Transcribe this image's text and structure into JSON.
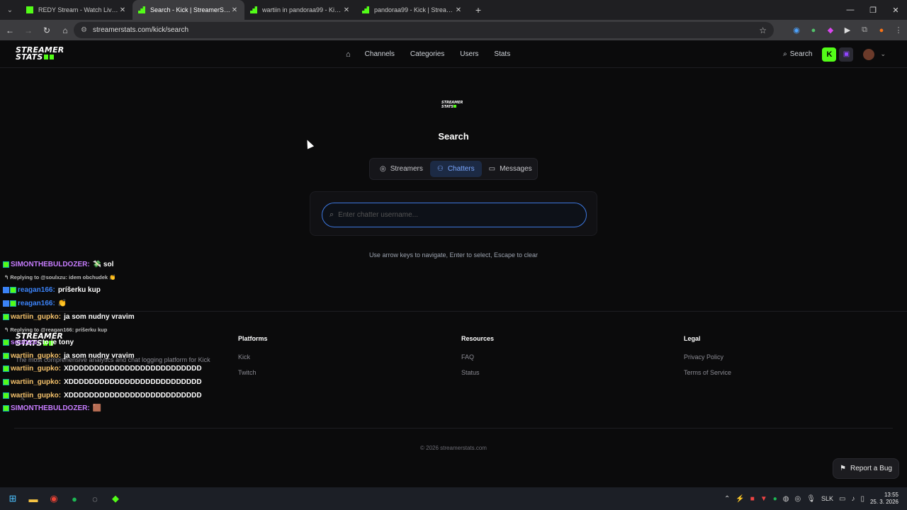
{
  "browser": {
    "tabs": [
      {
        "title": "REDY Stream - Watch Live on Kick",
        "favicon": "kick-icon",
        "color": "#53fc18",
        "active": false
      },
      {
        "title": "Search - Kick | StreamerStats",
        "favicon": "streamerstats-icon",
        "color": "#53fc18",
        "active": true
      },
      {
        "title": "wartiin in pandoraa99 - Kick | StreamerStats",
        "favicon": "streamerstats-icon",
        "color": "#53fc18",
        "active": false
      },
      {
        "title": "pandoraa99 - Kick | StreamerStats",
        "favicon": "streamerstats-icon",
        "color": "#53fc18",
        "active": false
      }
    ],
    "url": "streamerstats.com/kick/search"
  },
  "header": {
    "logo_line1": "STREAMER",
    "logo_line2": "STATS",
    "nav": [
      "Channels",
      "Categories",
      "Users",
      "Stats"
    ],
    "search_label": "Search"
  },
  "main": {
    "mini_logo_line1": "STREAMER",
    "mini_logo_line2": "STATS",
    "title": "Search",
    "segments": [
      {
        "label": "Streamers",
        "icon": "broadcast-icon",
        "active": false
      },
      {
        "label": "Chatters",
        "icon": "users-icon",
        "active": true
      },
      {
        "label": "Messages",
        "icon": "message-icon",
        "active": false
      }
    ],
    "search_placeholder": "Enter chatter username...",
    "hint": "Use arrow keys to navigate, Enter to select, Escape to clear"
  },
  "footer": {
    "logo_line1": "STREAMER",
    "logo_line2": "STATS",
    "tagline": "The most comprehensive analytics and chat logging platform for Kick",
    "columns": [
      {
        "heading": "Platforms",
        "links": [
          "Kick",
          "Twitch"
        ]
      },
      {
        "heading": "Resources",
        "links": [
          "FAQ",
          "Status"
        ]
      },
      {
        "heading": "Legal",
        "links": [
          "Privacy Policy",
          "Terms of Service"
        ]
      }
    ],
    "copyright": "© 2026 streamerstats.com",
    "report_bug": "Report a Bug"
  },
  "chat": [
    {
      "type": "msg",
      "user": "SIMONTHEBULDOZER:",
      "color": "#c77dff",
      "text": "💸 sol"
    },
    {
      "type": "reply",
      "text": "↰ Replying to @soulxzu: idem obchudek 👏"
    },
    {
      "type": "msg",
      "user": "reagan166:",
      "color": "#3b82f6",
      "text": "príšerku kup",
      "badge2": true
    },
    {
      "type": "msg",
      "user": "reagan166:",
      "color": "#3b82f6",
      "text": "👏",
      "badge2": true
    },
    {
      "type": "msg",
      "user": "wartiin_gupko:",
      "color": "#f5c26b",
      "text": "ja som nudny vravim"
    },
    {
      "type": "reply",
      "text": "↰ Replying to @reagan166: príšerku kup"
    },
    {
      "type": "msg",
      "user": "soulxzu:",
      "color": "#c77dff",
      "text": "to je tony"
    },
    {
      "type": "msg",
      "user": "wartiin_gupko:",
      "color": "#f5c26b",
      "text": "ja som nudny vravim"
    },
    {
      "type": "msg",
      "user": "wartiin_gupko:",
      "color": "#f5c26b",
      "text": "XDDDDDDDDDDDDDDDDDDDDDDDDDD"
    },
    {
      "type": "msg",
      "user": "wartiin_gupko:",
      "color": "#f5c26b",
      "text": "XDDDDDDDDDDDDDDDDDDDDDDDDDD"
    },
    {
      "type": "msg",
      "user": "wartiin_gupko:",
      "color": "#f5c26b",
      "text": "XDDDDDDDDDDDDDDDDDDDDDDDDDD"
    },
    {
      "type": "msg",
      "user": "SIMONTHEBULDOZER:",
      "color": "#c77dff",
      "text": "🟫"
    }
  ],
  "taskbar": {
    "language": "SLK",
    "time": "13:55",
    "date": "25. 3. 2026"
  },
  "colors": {
    "accent": "#53fc18",
    "active_tab": "#7aa7ff",
    "focus_ring": "#3d78e0"
  }
}
